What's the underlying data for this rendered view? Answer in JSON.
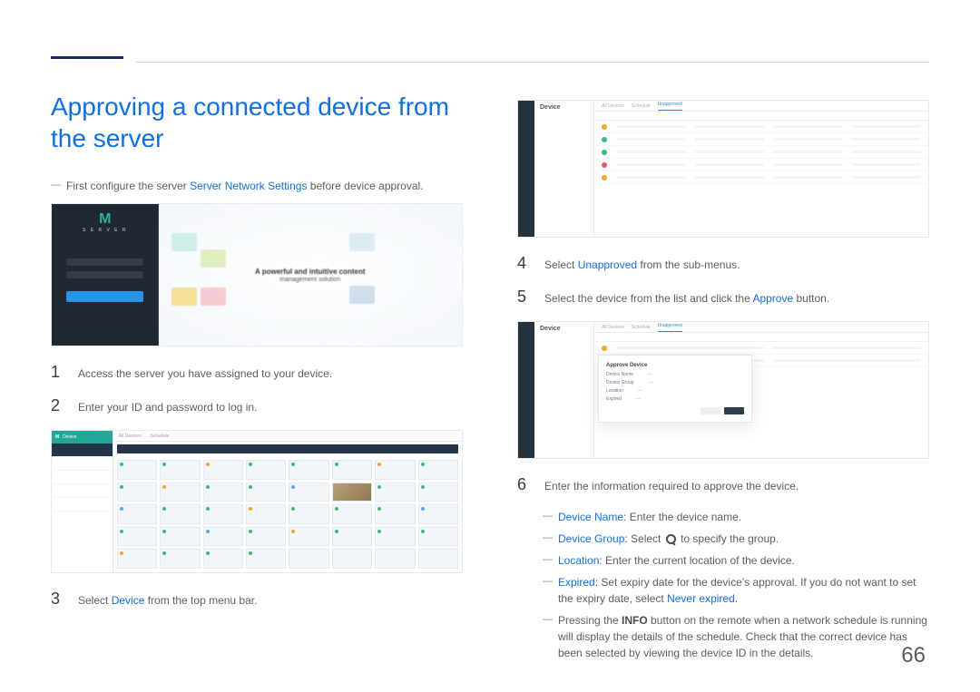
{
  "page_number": "66",
  "title": "Approving a connected device from the server",
  "intro_note": {
    "pre": "First configure the server ",
    "link": "Server Network Settings",
    "post": " before device approval."
  },
  "steps": {
    "s1": {
      "num": "1",
      "text": "Access the server you have assigned to your device."
    },
    "s2": {
      "num": "2",
      "text": "Enter your ID and password to log in."
    },
    "s3": {
      "num": "3",
      "pre": "Select ",
      "link": "Device",
      "post": " from the top menu bar."
    },
    "s4": {
      "num": "4",
      "pre": "Select ",
      "link": "Unapproved",
      "post": " from the sub-menus."
    },
    "s5": {
      "num": "5",
      "pre": "Select the device from the list and click the ",
      "link": "Approve",
      "post": " button."
    },
    "s6": {
      "num": "6",
      "text": "Enter the information required to approve the device."
    }
  },
  "subnotes": {
    "n1": {
      "link": "Device Name",
      "post": ": Enter the device name."
    },
    "n2": {
      "link": "Device Group",
      "post_a": ": Select ",
      "post_b": " to specify the group."
    },
    "n3": {
      "link": "Location",
      "post": ": Enter the current location of the device."
    },
    "n4": {
      "link": "Expired",
      "post": ": Set expiry date for the device's approval. If you do not want to set the expiry date, select ",
      "link2": "Never expired",
      "tail": "."
    },
    "n5": {
      "pre": "Pressing the ",
      "bold": "INFO",
      "post": " button on the remote when a network schedule is running will display the details of the schedule. Check that the correct device has been selected by viewing the device ID in the details."
    }
  },
  "fig1": {
    "logo_sub": "S E R V E R",
    "headline": "A powerful and intuitive content",
    "subhead": "management solution"
  },
  "fig2": {
    "side_label": "Device",
    "tabs": [
      "All Devices",
      "Schedule"
    ]
  },
  "fig3": {
    "side_head": "Device",
    "tabs": [
      "All Devices",
      "Schedule",
      "Unapproved"
    ]
  },
  "fig4": {
    "side_head": "Device",
    "modal_head": "Approve Device",
    "fields": {
      "name": "Device Name",
      "group": "Device Group",
      "location": "Location",
      "expired": "Expired"
    }
  }
}
